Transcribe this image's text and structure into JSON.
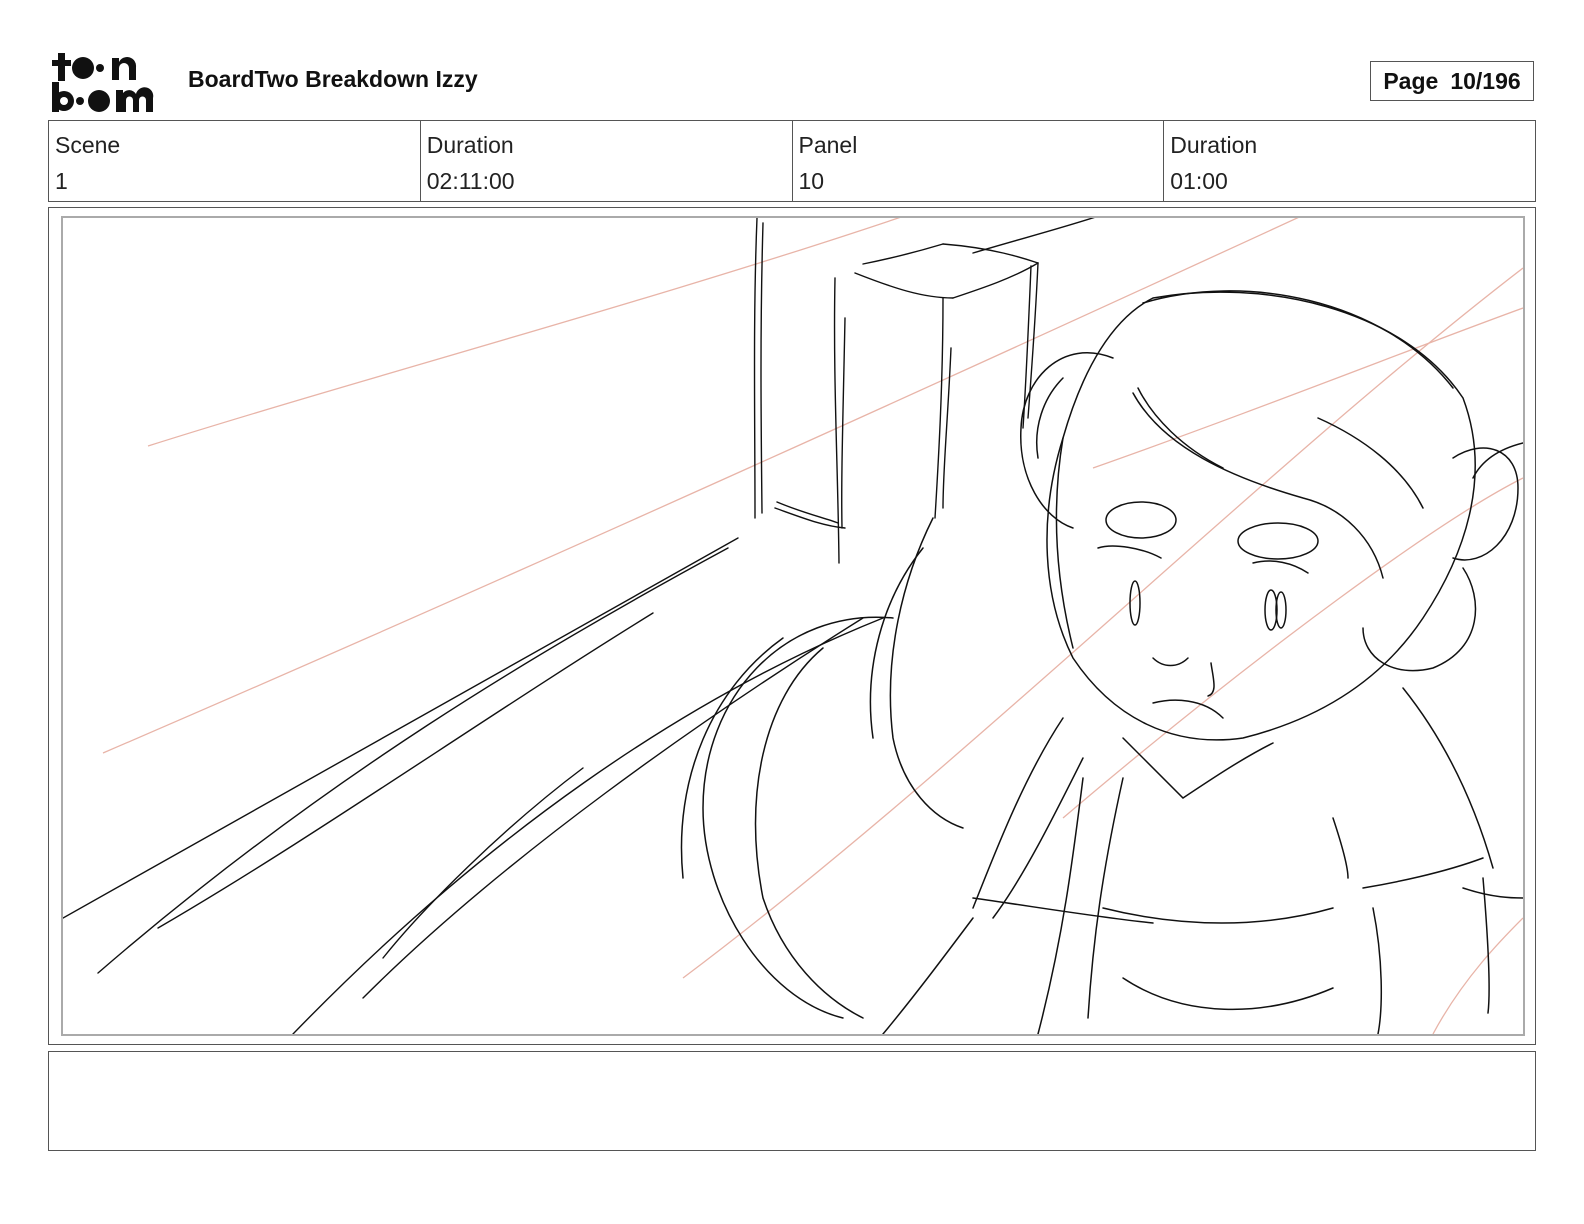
{
  "logo": {
    "text": "toon boom"
  },
  "header": {
    "title": "BoardTwo Breakdown Izzy",
    "page_label": "Page",
    "page_value": "10/196"
  },
  "info": {
    "scene_label": "Scene",
    "scene_value": "1",
    "scene_duration_label": "Duration",
    "scene_duration_value": "02:11:00",
    "panel_label": "Panel",
    "panel_value": "10",
    "panel_duration_label": "Duration",
    "panel_duration_value": "01:00"
  },
  "panel": {
    "image_description": "rough pencil sketch of a girl with bun hairstyle near a wall edge, red light rays",
    "line_color": "#111111",
    "light_ray_color": "#e8b4a8"
  },
  "notes": {
    "text": ""
  }
}
